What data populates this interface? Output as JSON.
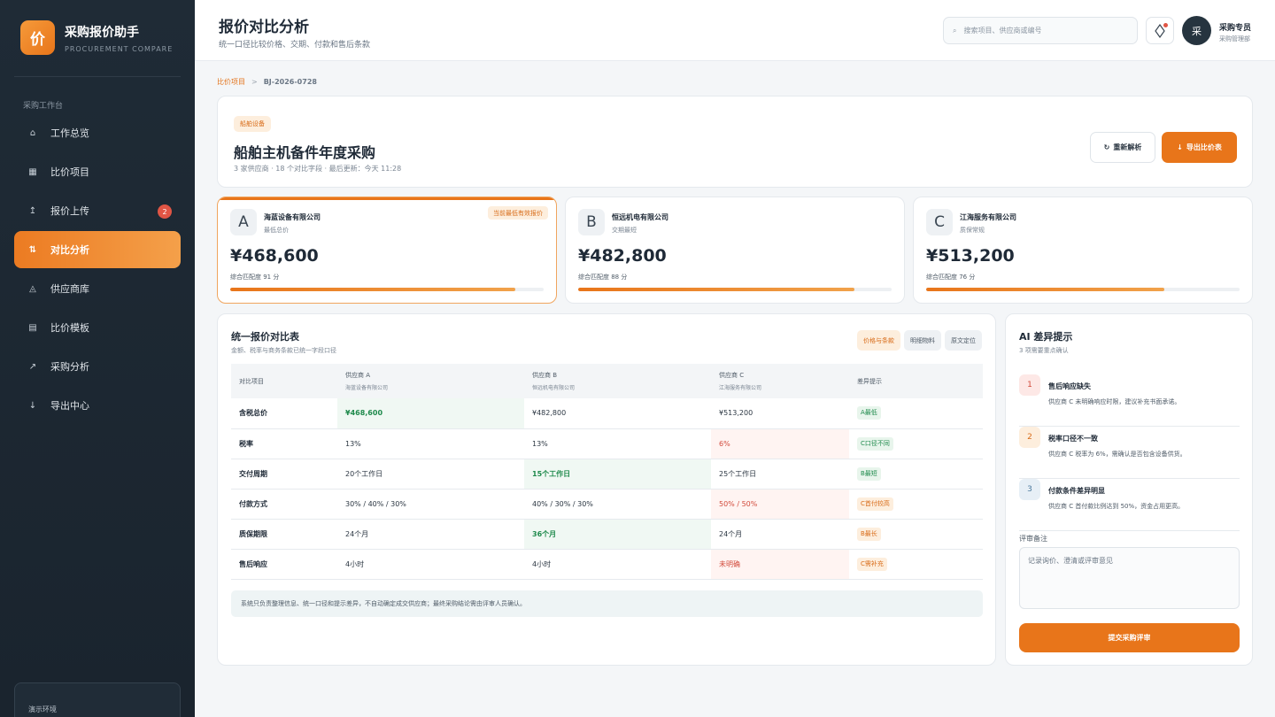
{
  "brand": {
    "logo_char": "价",
    "title": "采购报价助手",
    "subtitle": "PROCUREMENT COMPARE"
  },
  "sidebar": {
    "section_label": "采购工作台",
    "items": [
      {
        "icon": "⌂",
        "label": "工作总览",
        "badge": ""
      },
      {
        "icon": "▦",
        "label": "比价项目",
        "badge": ""
      },
      {
        "icon": "↥",
        "label": "报价上传",
        "badge": "2"
      },
      {
        "icon": "⇅",
        "label": "对比分析",
        "badge": ""
      },
      {
        "icon": "◬",
        "label": "供应商库",
        "badge": ""
      },
      {
        "icon": "▤",
        "label": "比价模板",
        "badge": ""
      },
      {
        "icon": "↗",
        "label": "采购分析",
        "badge": ""
      },
      {
        "icon": "↓",
        "label": "导出中心",
        "badge": ""
      }
    ],
    "env_label": "演示环境"
  },
  "header": {
    "title": "报价对比分析",
    "subtitle": "统一口径比较价格、交期、付款和售后条款",
    "search_placeholder": "搜索项目、供应商或编号",
    "avatar_char": "采",
    "user_name": "采购专员",
    "user_role": "采购管理部"
  },
  "breadcrumb": {
    "parent": "比价项目",
    "separator": ">",
    "current": "BJ-2026-0728"
  },
  "project": {
    "tag": "船舶设备",
    "title": "船舶主机备件年度采购",
    "meta": "3 家供应商 · 18 个对比字段 · 最后更新：今天 11:28",
    "reparse_icon": "↻",
    "reparse_label": "重新解析",
    "export_icon": "↓",
    "export_label": "导出比价表"
  },
  "suppliers": [
    {
      "letter": "A",
      "name": "海蓝设备有限公司",
      "note": "最低总价",
      "flag": "当前最低有效报价",
      "price": "¥468,600",
      "score_text": "综合匹配度 91 分",
      "score": 91
    },
    {
      "letter": "B",
      "name": "恒远机电有限公司",
      "note": "交期最短",
      "flag": "",
      "price": "¥482,800",
      "score_text": "综合匹配度 88 分",
      "score": 88
    },
    {
      "letter": "C",
      "name": "江海服务有限公司",
      "note": "质保常规",
      "flag": "",
      "price": "¥513,200",
      "score_text": "综合匹配度 76 分",
      "score": 76
    }
  ],
  "comparison": {
    "title": "统一报价对比表",
    "subtitle": "金额、税率与商务条款已统一字段口径",
    "tabs": [
      "价格与条款",
      "明细物料",
      "原文定位"
    ],
    "headers": {
      "item": "对比项目",
      "a": "供应商 A",
      "a_sub": "海蓝设备有限公司",
      "b": "供应商 B",
      "b_sub": "恒远机电有限公司",
      "c": "供应商 C",
      "c_sub": "江海服务有限公司",
      "diff": "差异提示"
    },
    "rows": [
      {
        "label": "含税总价",
        "a": "¥468,600",
        "b": "¥482,800",
        "c": "¥513,200",
        "diff": "A最低"
      },
      {
        "label": "税率",
        "a": "13%",
        "b": "13%",
        "c": "6%",
        "diff": "C口径不同"
      },
      {
        "label": "交付周期",
        "a": "20个工作日",
        "b": "15个工作日",
        "c": "25个工作日",
        "diff": "B最短"
      },
      {
        "label": "付款方式",
        "a": "30% / 40% / 30%",
        "b": "40% / 30% / 30%",
        "c": "50% / 50%",
        "diff": "C首付较高"
      },
      {
        "label": "质保期限",
        "a": "24个月",
        "b": "36个月",
        "c": "24个月",
        "diff": "B最长"
      },
      {
        "label": "售后响应",
        "a": "4小时",
        "b": "4小时",
        "c": "未明确",
        "diff": "C需补充"
      }
    ],
    "notice": "系统只负责整理信息、统一口径和提示差异，不自动确定成交供应商；最终采购结论需由评审人员确认。"
  },
  "ai": {
    "title": "AI 差异提示",
    "subtitle": "3 项需要重点确认",
    "items": [
      {
        "num": "1",
        "title": "售后响应缺失",
        "desc": "供应商 C 未明确响应时限，建议补充书面承诺。"
      },
      {
        "num": "2",
        "title": "税率口径不一致",
        "desc": "供应商 C 税率为 6%，需确认是否包含设备供货。"
      },
      {
        "num": "3",
        "title": "付款条件差异明显",
        "desc": "供应商 C 首付款比例达到 50%，资金占用更高。"
      }
    ],
    "note_label": "评审备注",
    "note_placeholder": "记录询价、澄清或评审意见",
    "submit_label": "提交采购评审"
  }
}
